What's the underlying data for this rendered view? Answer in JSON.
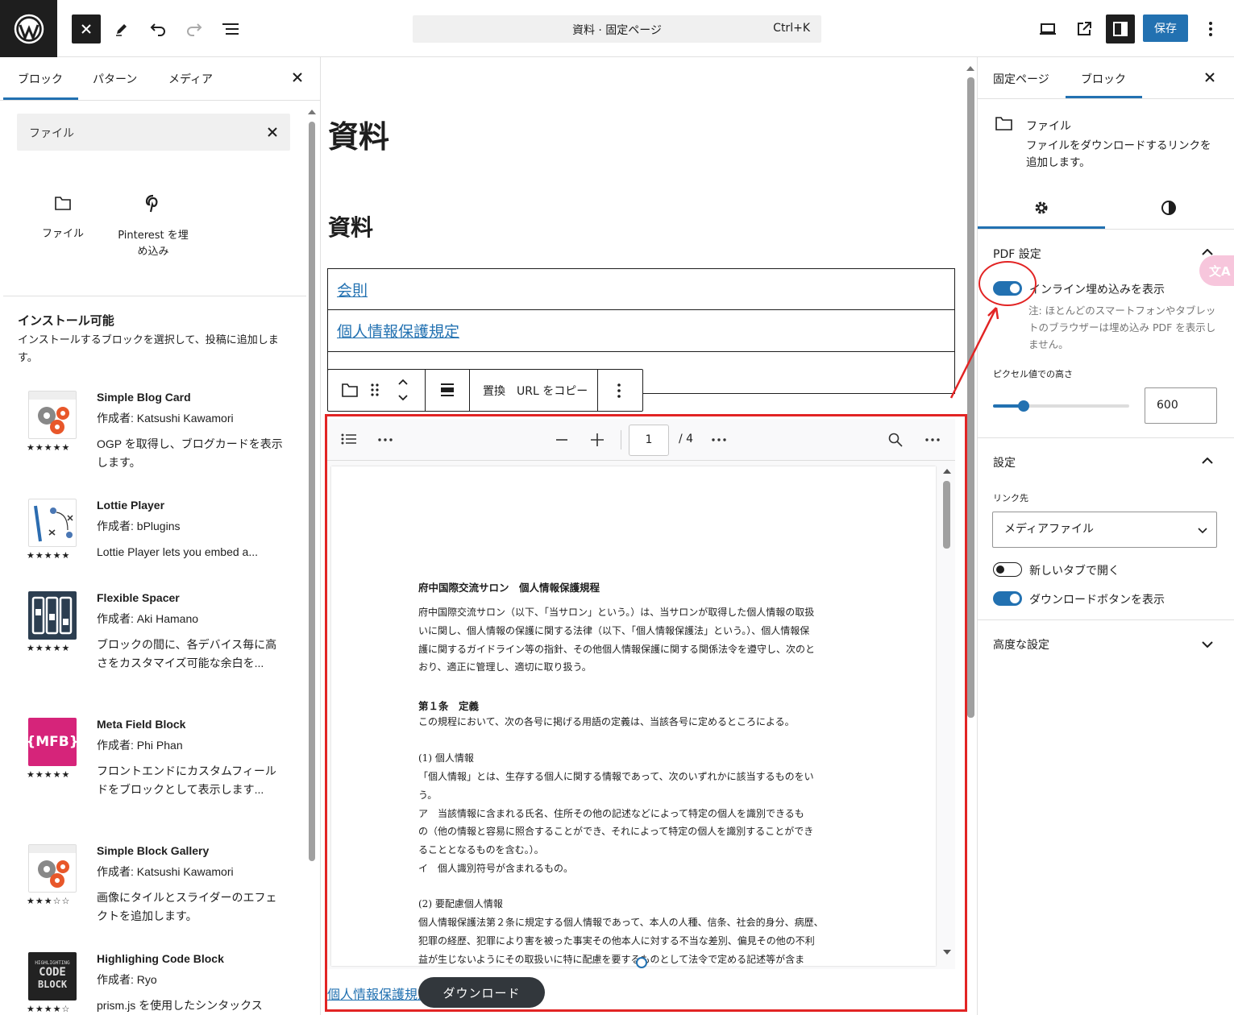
{
  "topbar": {
    "command_title": "資料 · 固定ページ",
    "command_shortcut": "Ctrl+K",
    "save_label": "保存"
  },
  "inserter": {
    "tabs": [
      "ブロック",
      "パターン",
      "メディア"
    ],
    "search_value": "ファイル",
    "results": [
      {
        "label": "ファイル",
        "icon": "folder-icon"
      },
      {
        "label": "Pinterest を埋め込み",
        "icon": "pinterest-icon"
      }
    ],
    "installable_title": "インストール可能",
    "installable_desc": "インストールするブロックを選択して、投稿に追加します。",
    "plugins": [
      {
        "name": "Simple Blog Card",
        "author": "作成者: Katsushi Kawamori",
        "desc": "OGP を取得し、ブログカードを表示します。",
        "stars": "★★★★★"
      },
      {
        "name": "Lottie Player",
        "author": "作成者: bPlugins",
        "desc": "Lottie Player lets you embed a...",
        "stars": "★★★★★"
      },
      {
        "name": "Flexible Spacer",
        "author": "作成者: Aki Hamano",
        "desc": "ブロックの間に、各デバイス毎に高さをカスタマイズ可能な余白を...",
        "stars": "★★★★★"
      },
      {
        "name": "Meta Field Block",
        "author": "作成者: Phi Phan",
        "desc": "フロントエンドにカスタムフィールドをブロックとして表示します...",
        "stars": "★★★★★"
      },
      {
        "name": "Simple Block Gallery",
        "author": "作成者: Katsushi Kawamori",
        "desc": "画像にタイルとスライダーのエフェクトを追加します。",
        "stars": "★★★☆☆"
      },
      {
        "name": "Highlighing Code Block",
        "author": "作成者: Ryo",
        "desc": "prism.js を使用したシンタックス",
        "stars": "★★★★☆"
      }
    ],
    "mfb_text": "{MFB}",
    "code_thumb_lines": [
      "HIGHLIGHTING",
      "CODE",
      "BLOCK"
    ]
  },
  "canvas": {
    "title": "資料",
    "heading": "資料",
    "links": [
      "会則",
      "個人情報保護規定"
    ],
    "toolbar": {
      "replace": "置換",
      "copy_url": "URL をコピー"
    },
    "pdf": {
      "page": "1",
      "total": "/ 4",
      "doc_title": "府中国際交流サロン　個人情報保護規程",
      "para1": [
        "府中国際交流サロン（以下、「当サロン」という。）は、当サロンが取得した個人情報の取扱",
        "いに関し、個人情報の保護に関する法律（以下、「個人情報保護法」という。）、個人情報保",
        "護に関するガイドライン等の指針、その他個人情報保護に関する関係法令を遵守し、次のと",
        "おり、適正に管理し、適切に取り扱う。"
      ],
      "art1": "第１条　定義",
      "art1_text": "この規程において、次の各号に掲げる用語の定義は、当該各号に定めるところによる。",
      "sec1": "(1) 個人情報",
      "sec1_text": [
        "「個人情報」とは、生存する個人に関する情報であって、次のいずれかに該当するものをい",
        "う。",
        "ア　当該情報に含まれる氏名、住所その他の記述などによって特定の個人を識別できるも",
        "の（他の情報と容易に照合することができ、それによって特定の個人を識別することができ",
        "ることとなるものを含む。）。",
        "イ　個人識別符号が含まれるもの。"
      ],
      "sec2": "(2) 要配慮個人情報",
      "sec2_text": [
        "個人情報保護法第２条に規定する個人情報であって、本人の人種、信条、社会的身分、病歴、",
        "犯罪の経歴、犯罪により害を被った事実その他本人に対する不当な差別、偏見その他の不利",
        "益が生じないようにその取扱いに特に配慮を要するものとして法令で定める記述等が含ま"
      ]
    },
    "file_link": "個人情報保護規定",
    "download_label": "ダウンロード"
  },
  "settings": {
    "tabs": [
      "固定ページ",
      "ブロック"
    ],
    "block_name": "ファイル",
    "block_desc": "ファイルをダウンロードするリンクを追加します。",
    "pdf_panel_title": "PDF 設定",
    "inline_label": "インライン埋め込みを表示",
    "inline_help": "注: ほとんどのスマートフォンやタブレットのブラウザーは埋め込み PDF を表示しません。",
    "height_label": "ピクセル値での高さ",
    "height_value": "600",
    "height_slider_fraction": 0.23,
    "settings_panel_title": "設定",
    "link_to_label": "リンク先",
    "link_to_value": "メディアファイル",
    "new_tab_label": "新しいタブで開く",
    "show_download_label": "ダウンロードボタンを表示",
    "advanced_title": "高度な設定",
    "inline_enabled": true,
    "new_tab_enabled": false,
    "show_download_enabled": true
  },
  "colors": {
    "accent": "#2271b1",
    "annotation": "#e22424",
    "dark": "#1e1e1e"
  }
}
